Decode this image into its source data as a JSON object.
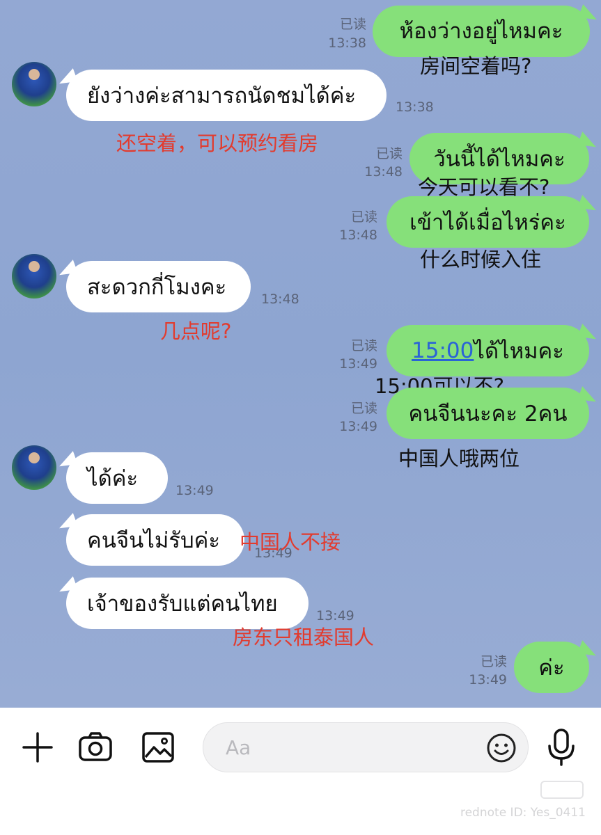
{
  "messages": {
    "m1": {
      "thai": "ห้องว่างอยู่ไหมคะ",
      "cn": "房间空着吗?",
      "read": "已读",
      "time": "13:38"
    },
    "m2": {
      "thai": "ยังว่างค่ะสามารถนัดชมได้ค่ะ",
      "time": "13:38",
      "cn": "还空着，可以预约看房"
    },
    "m3": {
      "thai": "วันนี้ได้ไหมคะ",
      "cn": "今天可以看不?",
      "read": "已读",
      "time": "13:48"
    },
    "m4": {
      "thai": "เข้าได้เมื่อไหร่คะ",
      "cn": "什么时候入住",
      "read": "已读",
      "time": "13:48"
    },
    "m5": {
      "thai": "สะดวกกี่โมงคะ",
      "time": "13:48",
      "cn": "几点呢?"
    },
    "m6": {
      "link": "15:00",
      "thai": "ได้ไหมคะ",
      "cn": "15:00可以不?",
      "read": "已读",
      "time": "13:49"
    },
    "m7": {
      "thai": "คนจีนนะคะ 2คน",
      "cn": "中国人哦两位",
      "read": "已读",
      "time": "13:49"
    },
    "m8": {
      "thai": "ได้ค่ะ",
      "time": "13:49"
    },
    "m9": {
      "thai": "คนจีนไม่รับค่ะ",
      "time": "13:49",
      "cn": "中国人不接"
    },
    "m10": {
      "thai": "เจ้าของรับแต่คนไทย",
      "time": "13:49",
      "cn": "房东只租泰国人"
    },
    "m11": {
      "thai": "ค่ะ",
      "read": "已读",
      "time": "13:49"
    }
  },
  "toolbar": {
    "input_placeholder": "Aa",
    "icons": [
      "plus-icon",
      "camera-icon",
      "image-icon",
      "emoji-icon",
      "microphone-icon"
    ]
  },
  "watermark": "rednote ID: Yes_0411",
  "colors": {
    "chat_bg": "#93a8d3",
    "outgoing_bubble": "#86e07a",
    "incoming_bubble": "#ffffff",
    "annotation_red": "#e23b2e",
    "link": "#2a64d6"
  }
}
